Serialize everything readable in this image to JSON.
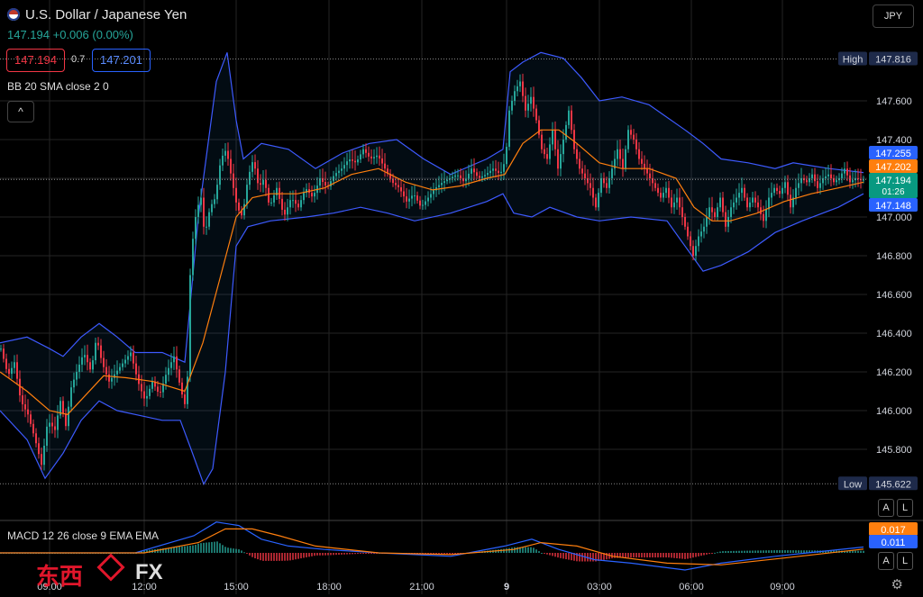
{
  "header": {
    "title": "U.S. Dollar / Japanese Yen",
    "last": "147.194",
    "change": "+0.006 (0.00%)",
    "bid": "147.194",
    "ask": "147.201",
    "spread": "0.7",
    "indicator_label": "BB 20 SMA close 2 0",
    "currency": "JPY",
    "collapse_glyph": "^"
  },
  "macd": {
    "label": "MACD 12 26 close 9 EMA EMA",
    "value_orange": "0.017",
    "value_blue": "0.011"
  },
  "price_tags": {
    "high_label": "High",
    "high": "147.816",
    "low_label": "Low",
    "low": "145.622",
    "upper": "147.255",
    "middle": "147.202",
    "last": "147.194",
    "countdown": "01:26",
    "lower": "147.148"
  },
  "buttons": {
    "auto": "A",
    "log": "L"
  },
  "watermark": {
    "cn": "东西",
    "fx": "FX"
  },
  "colors": {
    "up": "#26a69a",
    "down": "#f23645",
    "band": "#3d5afe",
    "basis": "#ff7f0e",
    "bg": "#000000",
    "grid": "#242424"
  },
  "chart_data": {
    "type": "candlestick",
    "ylim": [
      145.6,
      147.9
    ],
    "y_ticks": [
      "147.600",
      "147.400",
      "147.200",
      "147.000",
      "146.800",
      "146.600",
      "146.400",
      "146.200",
      "146.000",
      "145.800"
    ],
    "x_ticks": [
      "09:00",
      "12:00",
      "15:00",
      "18:00",
      "21:00",
      "9",
      "03:00",
      "06:00",
      "09:00"
    ],
    "series": {
      "close_path": [
        [
          0,
          146.32
        ],
        [
          8,
          146.18
        ],
        [
          15,
          146.25
        ],
        [
          22,
          146.05
        ],
        [
          30,
          145.98
        ],
        [
          38,
          145.85
        ],
        [
          45,
          145.72
        ],
        [
          52,
          145.95
        ],
        [
          60,
          145.9
        ],
        [
          66,
          146.05
        ],
        [
          72,
          145.92
        ],
        [
          78,
          146.12
        ],
        [
          84,
          146.2
        ],
        [
          92,
          146.3
        ],
        [
          100,
          146.2
        ],
        [
          106,
          146.38
        ],
        [
          112,
          146.25
        ],
        [
          120,
          146.15
        ],
        [
          128,
          146.2
        ],
        [
          136,
          146.25
        ],
        [
          144,
          146.3
        ],
        [
          152,
          146.15
        ],
        [
          160,
          146.05
        ],
        [
          168,
          146.15
        ],
        [
          176,
          146.08
        ],
        [
          184,
          146.2
        ],
        [
          192,
          146.28
        ],
        [
          200,
          146.1
        ],
        [
          206,
          146.0
        ],
        [
          210,
          146.7
        ],
        [
          214,
          146.95
        ],
        [
          218,
          147.05
        ],
        [
          222,
          147.1
        ],
        [
          226,
          146.9
        ],
        [
          232,
          147.05
        ],
        [
          238,
          147.1
        ],
        [
          244,
          147.3
        ],
        [
          250,
          147.35
        ],
        [
          256,
          147.2
        ],
        [
          262,
          147.05
        ],
        [
          268,
          147.0
        ],
        [
          274,
          147.2
        ],
        [
          280,
          147.3
        ],
        [
          286,
          147.15
        ],
        [
          292,
          147.2
        ],
        [
          298,
          147.05
        ],
        [
          306,
          147.15
        ],
        [
          314,
          147.0
        ],
        [
          322,
          147.1
        ],
        [
          330,
          147.05
        ],
        [
          338,
          147.15
        ],
        [
          346,
          147.1
        ],
        [
          354,
          147.2
        ],
        [
          362,
          147.15
        ],
        [
          370,
          147.22
        ],
        [
          378,
          147.25
        ],
        [
          386,
          147.3
        ],
        [
          394,
          147.28
        ],
        [
          402,
          147.35
        ],
        [
          410,
          147.3
        ],
        [
          418,
          147.32
        ],
        [
          426,
          147.25
        ],
        [
          434,
          147.18
        ],
        [
          442,
          147.15
        ],
        [
          450,
          147.08
        ],
        [
          458,
          147.12
        ],
        [
          466,
          147.05
        ],
        [
          474,
          147.1
        ],
        [
          482,
          147.15
        ],
        [
          490,
          147.18
        ],
        [
          498,
          147.2
        ],
        [
          506,
          147.22
        ],
        [
          514,
          147.18
        ],
        [
          522,
          147.25
        ],
        [
          530,
          147.2
        ],
        [
          538,
          147.22
        ],
        [
          546,
          147.25
        ],
        [
          554,
          147.22
        ],
        [
          560,
          147.3
        ],
        [
          564,
          147.55
        ],
        [
          570,
          147.65
        ],
        [
          576,
          147.7
        ],
        [
          582,
          147.55
        ],
        [
          588,
          147.62
        ],
        [
          594,
          147.5
        ],
        [
          600,
          147.35
        ],
        [
          606,
          147.3
        ],
        [
          612,
          147.45
        ],
        [
          618,
          147.25
        ],
        [
          624,
          147.4
        ],
        [
          630,
          147.55
        ],
        [
          636,
          147.35
        ],
        [
          642,
          147.25
        ],
        [
          648,
          147.2
        ],
        [
          654,
          147.15
        ],
        [
          660,
          147.05
        ],
        [
          666,
          147.2
        ],
        [
          672,
          147.15
        ],
        [
          678,
          147.25
        ],
        [
          684,
          147.35
        ],
        [
          690,
          147.25
        ],
        [
          696,
          147.45
        ],
        [
          702,
          147.4
        ],
        [
          708,
          147.3
        ],
        [
          714,
          147.25
        ],
        [
          720,
          147.2
        ],
        [
          726,
          147.15
        ],
        [
          732,
          147.1
        ],
        [
          738,
          147.15
        ],
        [
          744,
          147.05
        ],
        [
          750,
          147.1
        ],
        [
          756,
          147.0
        ],
        [
          762,
          146.9
        ],
        [
          768,
          146.8
        ],
        [
          774,
          146.9
        ],
        [
          780,
          146.95
        ],
        [
          786,
          147.05
        ],
        [
          792,
          147.0
        ],
        [
          798,
          147.1
        ],
        [
          804,
          146.95
        ],
        [
          810,
          147.05
        ],
        [
          816,
          147.1
        ],
        [
          822,
          147.15
        ],
        [
          828,
          147.05
        ],
        [
          834,
          147.1
        ],
        [
          840,
          147.05
        ],
        [
          846,
          146.98
        ],
        [
          852,
          147.1
        ],
        [
          858,
          147.15
        ],
        [
          864,
          147.12
        ],
        [
          870,
          147.18
        ],
        [
          876,
          147.05
        ],
        [
          882,
          147.15
        ],
        [
          888,
          147.2
        ],
        [
          894,
          147.18
        ],
        [
          900,
          147.22
        ],
        [
          906,
          147.15
        ],
        [
          912,
          147.2
        ],
        [
          918,
          147.22
        ],
        [
          924,
          147.18
        ],
        [
          930,
          147.2
        ],
        [
          936,
          147.25
        ],
        [
          942,
          147.18
        ],
        [
          948,
          147.2
        ],
        [
          954,
          147.19
        ],
        [
          958,
          147.194
        ]
      ],
      "bb_upper": [
        [
          0,
          146.35
        ],
        [
          30,
          146.38
        ],
        [
          55,
          146.32
        ],
        [
          70,
          146.28
        ],
        [
          90,
          146.38
        ],
        [
          110,
          146.45
        ],
        [
          130,
          146.38
        ],
        [
          150,
          146.3
        ],
        [
          180,
          146.3
        ],
        [
          205,
          146.25
        ],
        [
          220,
          147.0
        ],
        [
          240,
          147.7
        ],
        [
          252,
          147.85
        ],
        [
          262,
          147.5
        ],
        [
          270,
          147.3
        ],
        [
          290,
          147.38
        ],
        [
          320,
          147.35
        ],
        [
          350,
          147.25
        ],
        [
          380,
          147.33
        ],
        [
          410,
          147.38
        ],
        [
          440,
          147.4
        ],
        [
          470,
          147.3
        ],
        [
          500,
          147.22
        ],
        [
          540,
          147.3
        ],
        [
          558,
          147.35
        ],
        [
          566,
          147.75
        ],
        [
          580,
          147.8
        ],
        [
          600,
          147.85
        ],
        [
          625,
          147.82
        ],
        [
          645,
          147.72
        ],
        [
          665,
          147.6
        ],
        [
          690,
          147.62
        ],
        [
          720,
          147.58
        ],
        [
          760,
          147.45
        ],
        [
          780,
          147.38
        ],
        [
          800,
          147.3
        ],
        [
          830,
          147.28
        ],
        [
          860,
          147.25
        ],
        [
          880,
          147.28
        ],
        [
          920,
          147.25
        ],
        [
          958,
          147.23
        ]
      ],
      "bb_lower": [
        [
          0,
          146.0
        ],
        [
          30,
          145.85
        ],
        [
          50,
          145.65
        ],
        [
          70,
          145.78
        ],
        [
          90,
          145.95
        ],
        [
          110,
          146.05
        ],
        [
          130,
          146.0
        ],
        [
          150,
          145.98
        ],
        [
          180,
          145.95
        ],
        [
          200,
          145.95
        ],
        [
          212,
          145.8
        ],
        [
          226,
          145.62
        ],
        [
          236,
          145.7
        ],
        [
          250,
          146.2
        ],
        [
          262,
          146.85
        ],
        [
          275,
          146.95
        ],
        [
          300,
          146.98
        ],
        [
          340,
          147.0
        ],
        [
          370,
          147.02
        ],
        [
          400,
          147.05
        ],
        [
          430,
          147.02
        ],
        [
          460,
          146.98
        ],
        [
          500,
          147.02
        ],
        [
          540,
          147.08
        ],
        [
          558,
          147.12
        ],
        [
          570,
          147.02
        ],
        [
          590,
          147.0
        ],
        [
          610,
          147.05
        ],
        [
          640,
          147.0
        ],
        [
          665,
          146.98
        ],
        [
          700,
          147.0
        ],
        [
          740,
          146.98
        ],
        [
          760,
          146.85
        ],
        [
          780,
          146.72
        ],
        [
          800,
          146.75
        ],
        [
          830,
          146.82
        ],
        [
          860,
          146.92
        ],
        [
          890,
          146.98
        ],
        [
          930,
          147.05
        ],
        [
          958,
          147.12
        ]
      ],
      "bb_basis": [
        [
          0,
          146.2
        ],
        [
          30,
          146.1
        ],
        [
          55,
          146.0
        ],
        [
          75,
          145.98
        ],
        [
          95,
          146.08
        ],
        [
          115,
          146.18
        ],
        [
          140,
          146.17
        ],
        [
          170,
          146.15
        ],
        [
          205,
          146.1
        ],
        [
          225,
          146.35
        ],
        [
          245,
          146.7
        ],
        [
          262,
          147.0
        ],
        [
          280,
          147.1
        ],
        [
          300,
          147.12
        ],
        [
          330,
          147.12
        ],
        [
          360,
          147.15
        ],
        [
          390,
          147.22
        ],
        [
          420,
          147.25
        ],
        [
          450,
          147.18
        ],
        [
          480,
          147.14
        ],
        [
          510,
          147.16
        ],
        [
          540,
          147.2
        ],
        [
          560,
          147.22
        ],
        [
          580,
          147.38
        ],
        [
          600,
          147.45
        ],
        [
          620,
          147.45
        ],
        [
          640,
          147.38
        ],
        [
          665,
          147.28
        ],
        [
          690,
          147.25
        ],
        [
          720,
          147.25
        ],
        [
          750,
          147.2
        ],
        [
          770,
          147.05
        ],
        [
          790,
          146.98
        ],
        [
          810,
          146.98
        ],
        [
          840,
          147.02
        ],
        [
          870,
          147.08
        ],
        [
          900,
          147.12
        ],
        [
          930,
          147.15
        ],
        [
          958,
          147.18
        ]
      ]
    },
    "macd_series": {
      "macd": [
        [
          0,
          0.0
        ],
        [
          150,
          0.0
        ],
        [
          215,
          0.05
        ],
        [
          240,
          0.09
        ],
        [
          265,
          0.08
        ],
        [
          290,
          0.04
        ],
        [
          320,
          0.02
        ],
        [
          360,
          0.01
        ],
        [
          420,
          0.0
        ],
        [
          500,
          -0.01
        ],
        [
          560,
          0.02
        ],
        [
          590,
          0.04
        ],
        [
          620,
          0.01
        ],
        [
          660,
          -0.02
        ],
        [
          700,
          -0.03
        ],
        [
          760,
          -0.05
        ],
        [
          800,
          -0.03
        ],
        [
          860,
          -0.01
        ],
        [
          958,
          0.017
        ]
      ],
      "signal": [
        [
          0,
          0.0
        ],
        [
          160,
          0.0
        ],
        [
          220,
          0.03
        ],
        [
          250,
          0.07
        ],
        [
          280,
          0.07
        ],
        [
          310,
          0.05
        ],
        [
          350,
          0.02
        ],
        [
          420,
          0.0
        ],
        [
          500,
          -0.005
        ],
        [
          570,
          0.01
        ],
        [
          600,
          0.03
        ],
        [
          640,
          0.02
        ],
        [
          680,
          -0.01
        ],
        [
          740,
          -0.03
        ],
        [
          800,
          -0.035
        ],
        [
          870,
          -0.015
        ],
        [
          958,
          0.011
        ]
      ]
    }
  }
}
